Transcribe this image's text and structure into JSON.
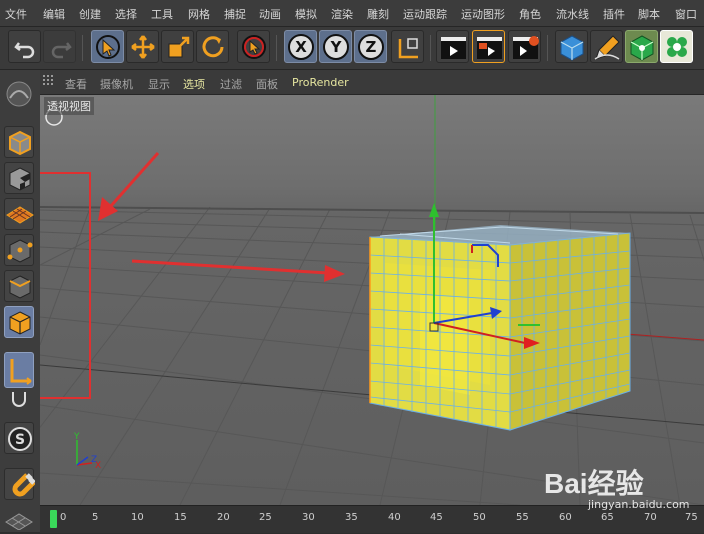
{
  "menu": [
    "文件",
    "编辑",
    "创建",
    "选择",
    "工具",
    "网格",
    "捕捉",
    "动画",
    "模拟",
    "渲染",
    "雕刻",
    "运动跟踪",
    "运动图形",
    "角色",
    "流水线",
    "插件",
    "脚本",
    "窗口"
  ],
  "viewport_menu": [
    "查看",
    "摄像机",
    "显示",
    "选项",
    "过滤",
    "面板",
    "ProRender"
  ],
  "viewport_menu_highlight": [
    "选项",
    "ProRender"
  ],
  "viewport_label": "透视视图",
  "toolbar": {
    "icons": [
      "undo-icon",
      "redo-icon",
      "live-selection-icon",
      "move-icon",
      "scale-icon",
      "rotate-icon",
      "last-tool-icon",
      "x-axis-icon",
      "y-axis-icon",
      "z-axis-icon",
      "world-coord-icon",
      "render-view-icon",
      "render-picture-queue-icon",
      "render-settings-icon",
      "cube-object-icon",
      "pen-spline-icon",
      "subdivision-icon",
      "cloner-icon"
    ],
    "x_label": "X",
    "y_label": "Y",
    "z_label": "Z"
  },
  "sidebar_icons": [
    "make-editable-icon",
    "model-mode-icon",
    "texture-mode-icon",
    "workplane-mode-icon",
    "points-mode-icon",
    "edges-mode-icon",
    "polygons-mode-icon",
    "axis-mode-icon",
    "magnet-icon",
    "snap-icon",
    "tweak-mode-icon",
    "grid-icon"
  ],
  "sidebar_snap_label": "S",
  "timeline": {
    "ticks": [
      "0",
      "5",
      "10",
      "15",
      "20",
      "25",
      "30",
      "35",
      "40",
      "45",
      "50",
      "55",
      "60",
      "65",
      "70",
      "75"
    ],
    "current_frame": 0
  },
  "axis_gizmo": {
    "y": "Y",
    "z": "Z",
    "x": "X"
  },
  "watermark": {
    "brand": "Bai经验",
    "url": "jingyan.baidu.com"
  },
  "colors": {
    "accent_blue": "#5d6f8c",
    "annotation_red": "#e03030",
    "cube_yellow": "#e6e04a",
    "selection_orange": "#ff9a1a"
  }
}
